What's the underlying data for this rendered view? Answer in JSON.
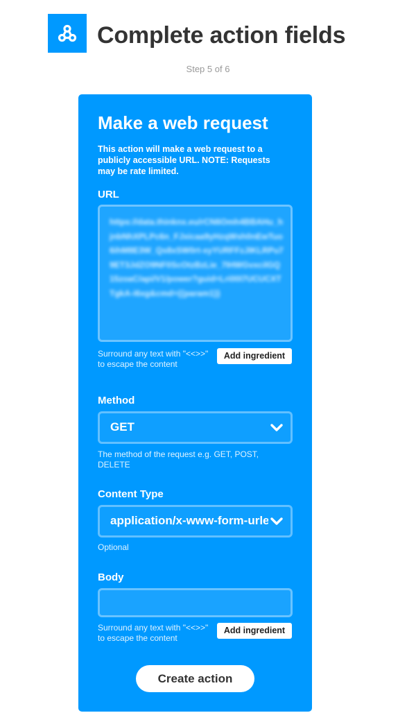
{
  "header": {
    "title": "Complete action fields",
    "step": "Step 5 of 6",
    "logo_icon": "webhooks-icon",
    "logo_color": "#0099ff"
  },
  "card": {
    "title": "Make a web request",
    "description": "This action will make a web request to a publicly accessible URL. NOTE: Requests may be rate limited.",
    "accent_color": "#0099ff"
  },
  "fields": {
    "url": {
      "label": "URL",
      "value": "https://data.thinknx.eu/rCN6Omh4BBAHu_hjnbNhXPLPc6n_FJxicaa9yHzqWsh0nEwTuo6ihM8E3W_Qs8xSW0rt-xyYURFFzJIKLRPu79ET3JdZO9NF0ScOtzBzLie_7IHWGvxcilGQ15zoaC/api/V1/power?guid=Lri00I7UCUCXTTgkA-i6xg&cmd={{param1}}",
      "help": "Surround any text with \"<<>>\" to escape the content",
      "ingredient_label": "Add ingredient"
    },
    "method": {
      "label": "Method",
      "value": "GET",
      "help": "The method of the request e.g. GET, POST, DELETE"
    },
    "content_type": {
      "label": "Content Type",
      "value": "application/x-www-form-urlencoded",
      "help": "Optional"
    },
    "body": {
      "label": "Body",
      "value": "",
      "help": "Surround any text with \"<<>>\" to escape the content",
      "ingredient_label": "Add ingredient"
    }
  },
  "actions": {
    "create_label": "Create action"
  }
}
